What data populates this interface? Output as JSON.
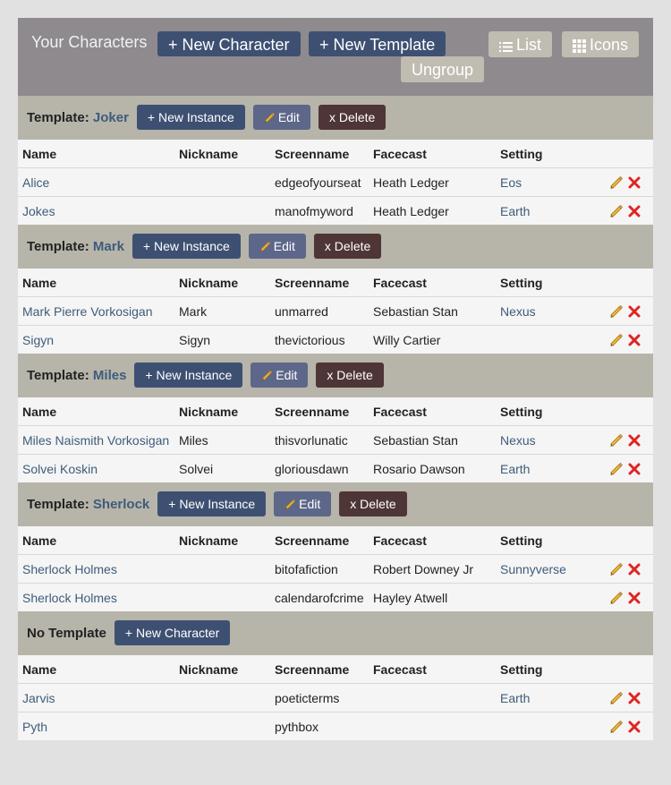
{
  "header": {
    "title": "Your Characters",
    "new_character": "+ New Character",
    "new_template": "+ New Template",
    "list": "List",
    "icons": "Icons",
    "ungroup": "Ungroup"
  },
  "labels": {
    "template_prefix": "Template: ",
    "new_instance": "+ New Instance",
    "edit": "Edit",
    "delete": "x Delete",
    "no_template": "No Template",
    "new_character": "+ New Character"
  },
  "columns": [
    "Name",
    "Nickname",
    "Screenname",
    "Facecast",
    "Setting"
  ],
  "groups": [
    {
      "template": "Joker",
      "rows": [
        {
          "name": "Alice",
          "nickname": "",
          "screenname": "edgeofyourseat",
          "facecast": "Heath Ledger",
          "setting": "Eos"
        },
        {
          "name": "Jokes",
          "nickname": "",
          "screenname": "manofmyword",
          "facecast": "Heath Ledger",
          "setting": "Earth"
        }
      ]
    },
    {
      "template": "Mark",
      "rows": [
        {
          "name": "Mark Pierre Vorkosigan",
          "nickname": "Mark",
          "screenname": "unmarred",
          "facecast": "Sebastian Stan",
          "setting": "Nexus"
        },
        {
          "name": "Sigyn",
          "nickname": "Sigyn",
          "screenname": "thevictorious",
          "facecast": "Willy Cartier",
          "setting": ""
        }
      ]
    },
    {
      "template": "Miles",
      "rows": [
        {
          "name": "Miles Naismith Vorkosigan",
          "nickname": "Miles",
          "screenname": "thisvorlunatic",
          "facecast": "Sebastian Stan",
          "setting": "Nexus"
        },
        {
          "name": "Solvei Koskin",
          "nickname": "Solvei",
          "screenname": "gloriousdawn",
          "facecast": "Rosario Dawson",
          "setting": "Earth"
        }
      ]
    },
    {
      "template": "Sherlock",
      "rows": [
        {
          "name": "Sherlock Holmes",
          "nickname": "",
          "screenname": "bitofafiction",
          "facecast": "Robert Downey Jr",
          "setting": "Sunnyverse"
        },
        {
          "name": "Sherlock Holmes",
          "nickname": "",
          "screenname": "calendarofcrime",
          "facecast": "Hayley Atwell",
          "setting": ""
        }
      ]
    }
  ],
  "untemplated": {
    "rows": [
      {
        "name": "Jarvis",
        "nickname": "",
        "screenname": "poeticterms",
        "facecast": "",
        "setting": "Earth"
      },
      {
        "name": "Pyth",
        "nickname": "",
        "screenname": "pythbox",
        "facecast": "",
        "setting": ""
      }
    ]
  },
  "colors": {
    "accent": "#3e5c7a",
    "navy_button": "#3e5072",
    "delete_button": "#4e3536",
    "header_bg": "#8e8a8e",
    "section_bg": "#b7b4aa"
  }
}
